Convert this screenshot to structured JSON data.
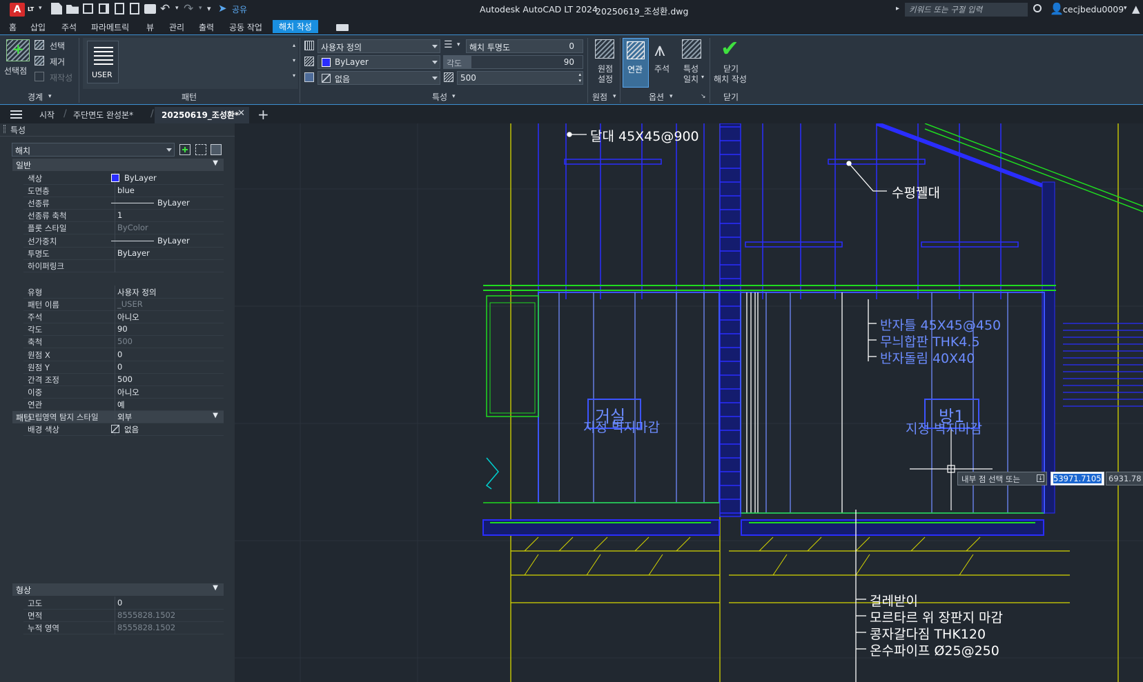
{
  "titlebar": {
    "logo": "A",
    "logo_sub": "LT",
    "share_label": "공유",
    "app_title": "Autodesk AutoCAD LT 2024",
    "file_name": "20250619_조성환.dwg",
    "search_placeholder": "키워드 또는 구절 입력",
    "username": "cecjbedu0009"
  },
  "menu": [
    "홈",
    "삽입",
    "주석",
    "파라메트릭",
    "뷰",
    "관리",
    "출력",
    "공동 작업",
    "해치 작성"
  ],
  "ribbon": {
    "boundary": {
      "pick_points": "선택점",
      "select": "선택",
      "remove": "제거",
      "recreate": "재작성",
      "title": "경계"
    },
    "pattern": {
      "swatch_label": "USER",
      "title": "패턴"
    },
    "properties": {
      "pattern_type": "사용자 정의",
      "transparency_label": "해치 투명도",
      "transparency_value": "0",
      "color": "ByLayer",
      "angle_label": "각도",
      "angle_value": "90",
      "background": "없음",
      "spacing_value": "500",
      "title": "특성"
    },
    "origin": {
      "set_origin": "원점\n설정",
      "set_origin_1": "원점",
      "set_origin_2": "설정",
      "title": "원점"
    },
    "options": {
      "associative": "연관",
      "annotative": "주석",
      "match_1": "특성",
      "match_2": "일치",
      "title": "옵션"
    },
    "close": {
      "label_1": "닫기",
      "label_2": "해치 작성",
      "title": "닫기"
    }
  },
  "tabs": {
    "start": "시작",
    "tab1": "주단면도 완성본*",
    "tab2": "20250619_조성환*"
  },
  "properties_panel": {
    "title": "특성",
    "selection": "해치",
    "general": {
      "title": "일반",
      "rows": [
        {
          "k": "색상",
          "v": "ByLayer"
        },
        {
          "k": "도면층",
          "v": "blue"
        },
        {
          "k": "선종류",
          "v": "ByLayer"
        },
        {
          "k": "선종류 축척",
          "v": "1"
        },
        {
          "k": "플롯 스타일",
          "v": "ByColor"
        },
        {
          "k": "선가중치",
          "v": "ByLayer"
        },
        {
          "k": "투명도",
          "v": "ByLayer"
        },
        {
          "k": "하이퍼링크",
          "v": ""
        }
      ]
    },
    "pattern": {
      "title": "패턴",
      "rows": [
        {
          "k": "유형",
          "v": "사용자 정의"
        },
        {
          "k": "패턴 이름",
          "v": "_USER"
        },
        {
          "k": "주석",
          "v": "아니오"
        },
        {
          "k": "각도",
          "v": "90"
        },
        {
          "k": "축척",
          "v": "500"
        },
        {
          "k": "원점 X",
          "v": "0"
        },
        {
          "k": "원점 Y",
          "v": "0"
        },
        {
          "k": "간격 조정",
          "v": "500"
        },
        {
          "k": "이중",
          "v": "아니오"
        },
        {
          "k": "연관",
          "v": "예"
        },
        {
          "k": "고립영역 탐지 스타일",
          "v": "외부"
        },
        {
          "k": "배경 색상",
          "v": "없음"
        }
      ]
    },
    "geometry": {
      "title": "형상",
      "rows": [
        {
          "k": "고도",
          "v": "0"
        },
        {
          "k": "면적",
          "v": "8555828.1502"
        },
        {
          "k": "누적 영역",
          "v": "8555828.1502"
        }
      ]
    }
  },
  "drawing": {
    "label_hanger": "달대 45X45@900",
    "label_joist": "수평꿸대",
    "label_ceiling1": "반자틀 45X45@450",
    "label_ceiling2": "무늬합판 THK4.5",
    "label_ceiling3": "반자돌림 40X40",
    "room1": "거실",
    "room1_finish": "지정 벽지마감",
    "room2": "방1",
    "room2_finish": "지정 벽지마감",
    "floor1": "걸레받이",
    "floor2": "모르타르 위 장판지 마감",
    "floor3": "콩자갈다짐 THK120",
    "floor4": "온수파이프 Ø25@250",
    "prompt": "내부 점 선택 또는",
    "coord_x": "53971.7105",
    "coord_y": "6931.78"
  },
  "colors": {
    "accent": "#1a8fe0",
    "cad_background": "#212830",
    "cad_green": "#1fdc1f",
    "cad_yellow": "#e5e500",
    "cad_blue": "#2a2dff"
  }
}
